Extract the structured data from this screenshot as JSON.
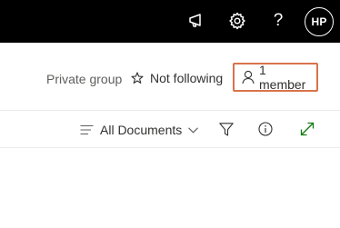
{
  "topbar": {
    "icons": [
      "megaphone-icon",
      "gear-icon",
      "help-icon"
    ],
    "help_glyph": "?",
    "avatar_initials": "HP"
  },
  "group_header": {
    "privacy_label": "Private group",
    "follow_label": "Not following",
    "members_label": "1 member"
  },
  "command_bar": {
    "view_label": "All Documents",
    "icons": [
      "filter-icon",
      "info-icon",
      "expand-icon"
    ]
  },
  "colors": {
    "topbar_bg": "#000000",
    "highlight_border": "#d9734a",
    "expand_icon": "#107c10",
    "muted_text": "#605e5c"
  }
}
